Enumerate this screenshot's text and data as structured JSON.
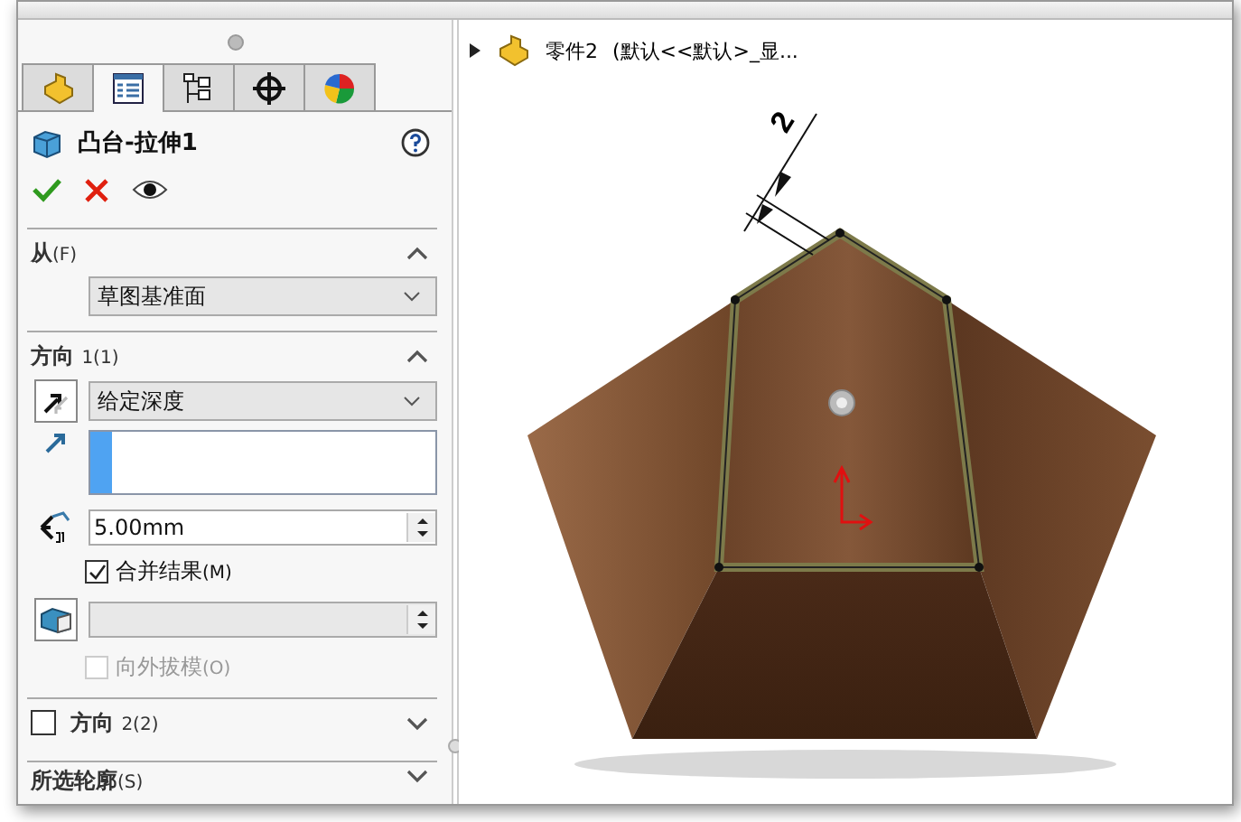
{
  "panel_tabs": [
    {
      "kind": "feature-manager",
      "selected": false
    },
    {
      "kind": "property-manager",
      "selected": true
    },
    {
      "kind": "configuration-manager",
      "selected": false
    },
    {
      "kind": "dimxpert",
      "selected": false
    },
    {
      "kind": "display-manager",
      "selected": false
    }
  ],
  "feature": {
    "title": "凸台-拉伸1"
  },
  "from_section": {
    "title": "从",
    "hotkey": "(F)",
    "expanded": true,
    "end_condition": "草图基准面"
  },
  "direction1": {
    "title": "方向",
    "suffix": "1(1)",
    "expanded": true,
    "end_condition": "给定深度",
    "depth": "5.00mm",
    "merge": {
      "label": "合并结果",
      "hotkey": "(M)",
      "checked": true,
      "disabled": false
    },
    "draft_outward": {
      "label": "向外拔模",
      "hotkey": "(O)",
      "checked": false,
      "disabled": true
    }
  },
  "direction2": {
    "title": "方向",
    "suffix": "2(2)",
    "checked": false,
    "expanded": false
  },
  "selected_contours": {
    "title": "所选轮廓",
    "hotkey": "(S)",
    "expanded": false
  },
  "tree": {
    "part": "零件2",
    "config": "(默认<<默认>_显..."
  },
  "dimension": {
    "value": "2"
  }
}
